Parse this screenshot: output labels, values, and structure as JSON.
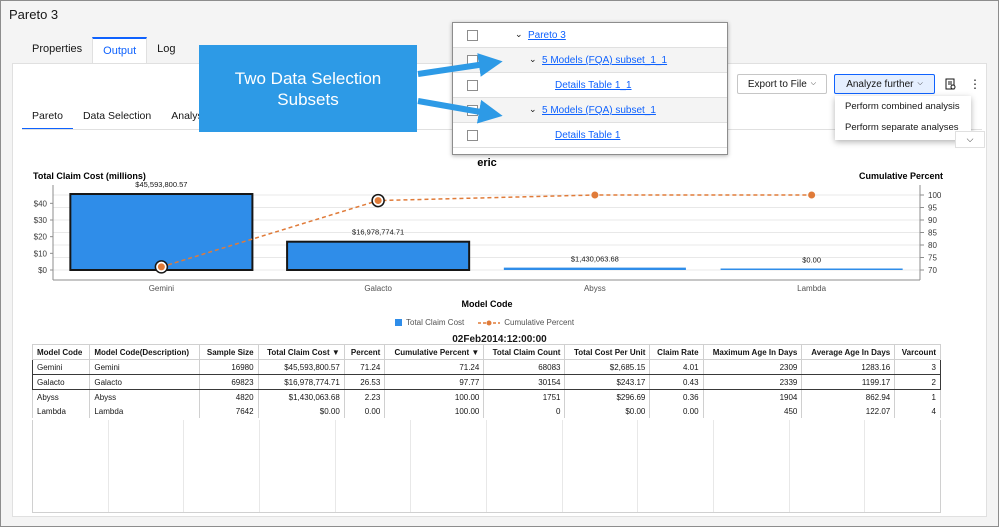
{
  "window": {
    "title": "Pareto 3"
  },
  "top_tabs": [
    {
      "label": "Properties"
    },
    {
      "label": "Output"
    },
    {
      "label": "Log"
    }
  ],
  "sub_tabs": [
    {
      "label": "Pareto"
    },
    {
      "label": "Data Selection"
    },
    {
      "label": "Analysis"
    }
  ],
  "toolbar": {
    "export_label": "Export to File",
    "analyze_label": "Analyze further"
  },
  "analyze_menu": [
    {
      "label": "Perform combined analysis"
    },
    {
      "label": "Perform separate analyses"
    }
  ],
  "tree": [
    {
      "label": "Pareto 3"
    },
    {
      "label": "5 Models (FQA) subset_1_1"
    },
    {
      "label": "Details Table 1_1"
    },
    {
      "label": "5 Models (FQA) subset_1"
    },
    {
      "label": "Details Table 1"
    }
  ],
  "callout": {
    "text": "Two Data Selection Subsets"
  },
  "colors": {
    "accent": "#0f62fe",
    "bar": "#2f8de9",
    "line": "#e07b39",
    "callout": "#2d9ae6"
  },
  "chart_data": {
    "type": "bar",
    "title": "eric",
    "ylabel": "Total Claim Cost (millions)",
    "y2label": "Cumulative Percent",
    "xlabel": "Model Code",
    "categories": [
      "Gemini",
      "Galacto",
      "Abyss",
      "Lambda"
    ],
    "series": [
      {
        "name": "Total Claim Cost",
        "values": [
          45.5938,
          16.9788,
          1.4301,
          0
        ],
        "labels": [
          "$45,593,800.57",
          "$16,978,774.71",
          "$1,430,063.68",
          "$0.00"
        ]
      },
      {
        "name": "Cumulative Percent",
        "values": [
          71.24,
          97.77,
          100,
          100
        ]
      }
    ],
    "ylim": [
      0,
      48
    ],
    "y_ticks": [
      "$0",
      "$10",
      "$20",
      "$30",
      "$40"
    ],
    "y2lim": [
      70,
      102
    ],
    "y2_ticks": [
      "70",
      "75",
      "80",
      "85",
      "90",
      "95",
      "100"
    ],
    "highlighted": [
      "Gemini",
      "Galacto"
    ],
    "grid": true,
    "legend": "bottom"
  },
  "table": {
    "title": "02Feb2014:12:00:00",
    "columns": [
      "Model Code",
      "Model Code(Description)",
      "Sample Size",
      "Total Claim Cost ▼",
      "Percent",
      "Cumulative Percent ▼",
      "Total Claim Count",
      "Total Cost Per Unit",
      "Claim Rate",
      "Maximum Age In Days",
      "Average Age In Days",
      "Varcount"
    ],
    "rows": [
      [
        "Gemini",
        "Gemini",
        "16980",
        "$45,593,800.57",
        "71.24",
        "71.24",
        "68083",
        "$2,685.15",
        "4.01",
        "2309",
        "1283.16",
        "3"
      ],
      [
        "Galacto",
        "Galacto",
        "69823",
        "$16,978,774.71",
        "26.53",
        "97.77",
        "30154",
        "$243.17",
        "0.43",
        "2339",
        "1199.17",
        "2"
      ],
      [
        "Abyss",
        "Abyss",
        "4820",
        "$1,430,063.68",
        "2.23",
        "100.00",
        "1751",
        "$296.69",
        "0.36",
        "1904",
        "862.94",
        "1"
      ],
      [
        "Lambda",
        "Lambda",
        "7642",
        "$0.00",
        "0.00",
        "100.00",
        "0",
        "$0.00",
        "0.00",
        "450",
        "122.07",
        "4"
      ]
    ]
  }
}
